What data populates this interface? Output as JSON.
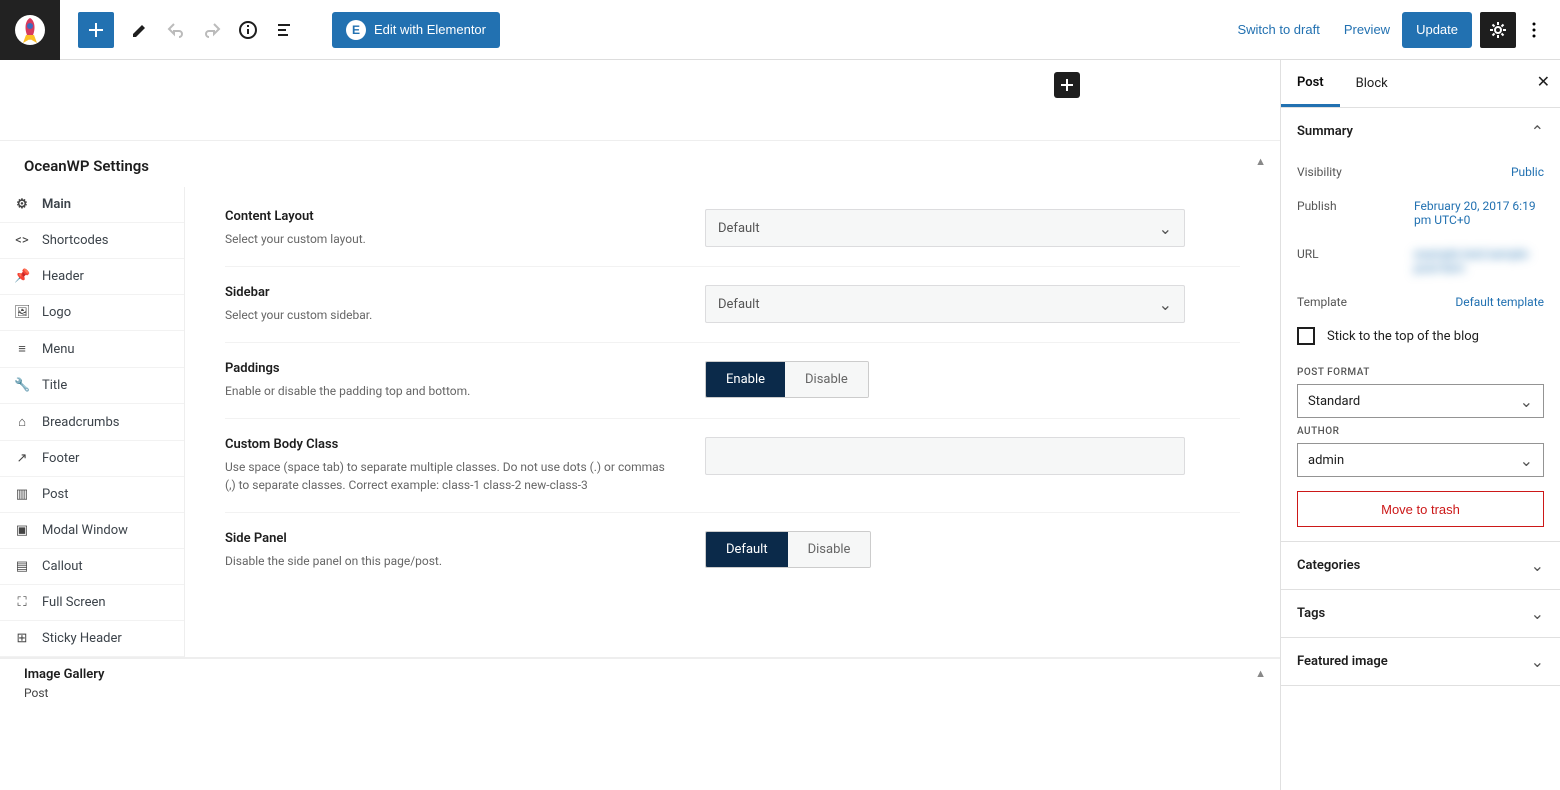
{
  "topbar": {
    "elementor_label": "Edit with Elementor",
    "switch_draft": "Switch to draft",
    "preview": "Preview",
    "update": "Update"
  },
  "owp": {
    "title": "OceanWP Settings",
    "tabs": [
      {
        "icon": "⚙",
        "label": "Main"
      },
      {
        "icon": "</>",
        "label": "Shortcodes"
      },
      {
        "icon": "📌",
        "label": "Header"
      },
      {
        "icon": "🖼",
        "label": "Logo"
      },
      {
        "icon": "≡",
        "label": "Menu"
      },
      {
        "icon": "🔧",
        "label": "Title"
      },
      {
        "icon": "⌂",
        "label": "Breadcrumbs"
      },
      {
        "icon": "↗",
        "label": "Footer"
      },
      {
        "icon": "▥",
        "label": "Post"
      },
      {
        "icon": "▣",
        "label": "Modal Window"
      },
      {
        "icon": "▤",
        "label": "Callout"
      },
      {
        "icon": "⛶",
        "label": "Full Screen"
      },
      {
        "icon": "⊞",
        "label": "Sticky Header"
      }
    ],
    "fields": {
      "content_layout": {
        "title": "Content Layout",
        "help": "Select your custom layout.",
        "value": "Default"
      },
      "sidebar": {
        "title": "Sidebar",
        "help": "Select your custom sidebar.",
        "value": "Default"
      },
      "paddings": {
        "title": "Paddings",
        "help": "Enable or disable the padding top and bottom.",
        "enable": "Enable",
        "disable": "Disable"
      },
      "body_class": {
        "title": "Custom Body Class",
        "help": "Use space (space tab) to separate multiple classes. Do not use dots (.) or commas (,) to separate classes. Correct example: class-1 class-2 new-class-3"
      },
      "side_panel": {
        "title": "Side Panel",
        "help": "Disable the side panel on this page/post.",
        "default": "Default",
        "disable": "Disable"
      }
    }
  },
  "bottom": {
    "title": "Image Gallery",
    "sub": "Post"
  },
  "sidebar": {
    "tabs": {
      "post": "Post",
      "block": "Block"
    },
    "summary": {
      "title": "Summary",
      "visibility_label": "Visibility",
      "visibility_value": "Public",
      "publish_label": "Publish",
      "publish_value": "February 20, 2017 6:19 pm UTC+0",
      "url_label": "URL",
      "url_value": "example.test/sample-post-item",
      "template_label": "Template",
      "template_value": "Default template",
      "stick_label": "Stick to the top of the blog",
      "post_format_label": "POST FORMAT",
      "post_format_value": "Standard",
      "author_label": "AUTHOR",
      "author_value": "admin",
      "trash": "Move to trash"
    },
    "sections": {
      "categories": "Categories",
      "tags": "Tags",
      "featured_image": "Featured image"
    }
  }
}
